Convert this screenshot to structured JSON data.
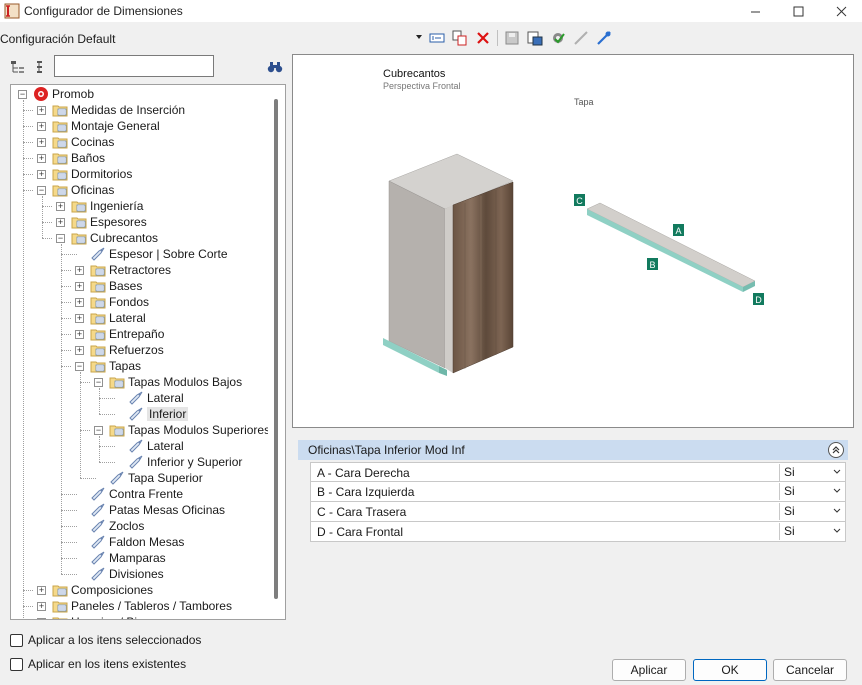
{
  "window": {
    "title": "Configurador de Dimensiones"
  },
  "config": {
    "selected": "Configuración Default"
  },
  "tree": {
    "search_value": "",
    "nodes": [
      {
        "label": "Promob",
        "level": 0,
        "icon": "promob-logo-icon",
        "expander": "−"
      },
      {
        "label": "Medidas de Inserción",
        "level": 1,
        "icon": "folder-icon",
        "expander": "+"
      },
      {
        "label": "Montaje General",
        "level": 1,
        "icon": "folder-icon",
        "expander": "+"
      },
      {
        "label": "Cocinas",
        "level": 1,
        "icon": "folder-icon",
        "expander": "+"
      },
      {
        "label": "Baños",
        "level": 1,
        "icon": "folder-icon",
        "expander": "+"
      },
      {
        "label": "Dormitorios",
        "level": 1,
        "icon": "folder-icon",
        "expander": "+"
      },
      {
        "label": "Oficinas",
        "level": 1,
        "icon": "folder-icon",
        "expander": "−"
      },
      {
        "label": "Ingeniería",
        "level": 2,
        "icon": "folder-icon",
        "expander": "+"
      },
      {
        "label": "Espesores",
        "level": 2,
        "icon": "folder-icon",
        "expander": "+"
      },
      {
        "label": "Cubrecantos",
        "level": 2,
        "icon": "folder-icon",
        "expander": "−"
      },
      {
        "label": "Espesor | Sobre Corte",
        "level": 3,
        "icon": "tag-icon",
        "expander": ""
      },
      {
        "label": "Retractores",
        "level": 3,
        "icon": "folder-icon",
        "expander": "+"
      },
      {
        "label": "Bases",
        "level": 3,
        "icon": "folder-icon",
        "expander": "+"
      },
      {
        "label": "Fondos",
        "level": 3,
        "icon": "folder-icon",
        "expander": "+"
      },
      {
        "label": "Lateral",
        "level": 3,
        "icon": "folder-icon",
        "expander": "+"
      },
      {
        "label": "Entrepaño",
        "level": 3,
        "icon": "folder-icon",
        "expander": "+"
      },
      {
        "label": "Refuerzos",
        "level": 3,
        "icon": "folder-icon",
        "expander": "+"
      },
      {
        "label": "Tapas",
        "level": 3,
        "icon": "folder-icon",
        "expander": "−"
      },
      {
        "label": "Tapas Modulos Bajos",
        "level": 4,
        "icon": "folder-icon",
        "expander": "−"
      },
      {
        "label": "Lateral",
        "level": 5,
        "icon": "tag-icon",
        "expander": ""
      },
      {
        "label": "Inferior",
        "level": 5,
        "icon": "tag-icon",
        "expander": "",
        "selected": true
      },
      {
        "label": "Tapas Modulos Superiores",
        "level": 4,
        "icon": "folder-icon",
        "expander": "−"
      },
      {
        "label": "Lateral",
        "level": 5,
        "icon": "tag-icon",
        "expander": ""
      },
      {
        "label": "Inferior y Superior",
        "level": 5,
        "icon": "tag-icon",
        "expander": ""
      },
      {
        "label": "Tapa Superior",
        "level": 4,
        "icon": "tag-icon",
        "expander": ""
      },
      {
        "label": "Contra Frente",
        "level": 3,
        "icon": "tag-icon",
        "expander": ""
      },
      {
        "label": "Patas Mesas Oficinas",
        "level": 3,
        "icon": "tag-icon",
        "expander": ""
      },
      {
        "label": "Zoclos",
        "level": 3,
        "icon": "tag-icon",
        "expander": ""
      },
      {
        "label": "Faldon Mesas",
        "level": 3,
        "icon": "tag-icon",
        "expander": ""
      },
      {
        "label": "Mamparas",
        "level": 3,
        "icon": "tag-icon",
        "expander": ""
      },
      {
        "label": "Divisiones",
        "level": 3,
        "icon": "tag-icon",
        "expander": ""
      },
      {
        "label": "Composiciones",
        "level": 1,
        "icon": "folder-icon",
        "expander": "+"
      },
      {
        "label": "Paneles / Tableros / Tambores",
        "level": 1,
        "icon": "folder-icon",
        "expander": "+"
      },
      {
        "label": "Herrajes / Bisagras",
        "level": 1,
        "icon": "folder-icon",
        "expander": "+"
      }
    ]
  },
  "options": {
    "apply_selected": "Aplicar a los itens seleccionados",
    "apply_existing": "Aplicar en los itens existentes"
  },
  "preview": {
    "title": "Cubrecantos",
    "subtitle": "Perspectiva Frontal",
    "part_label": "Tapa",
    "markers": [
      "A",
      "B",
      "C",
      "D"
    ],
    "edge_color": "#8fd0c4",
    "marker_color": "#127a5e"
  },
  "properties": {
    "header": "Oficinas\\Tapa Inferior Mod Inf",
    "rows": [
      {
        "label": "A - Cara Derecha",
        "value": "Si"
      },
      {
        "label": "B - Cara Izquierda",
        "value": "Si"
      },
      {
        "label": "C - Cara Trasera",
        "value": "Si"
      },
      {
        "label": "D - Cara Frontal",
        "value": "Si"
      }
    ]
  },
  "buttons": {
    "apply": "Aplicar",
    "ok": "OK",
    "cancel": "Cancelar"
  }
}
